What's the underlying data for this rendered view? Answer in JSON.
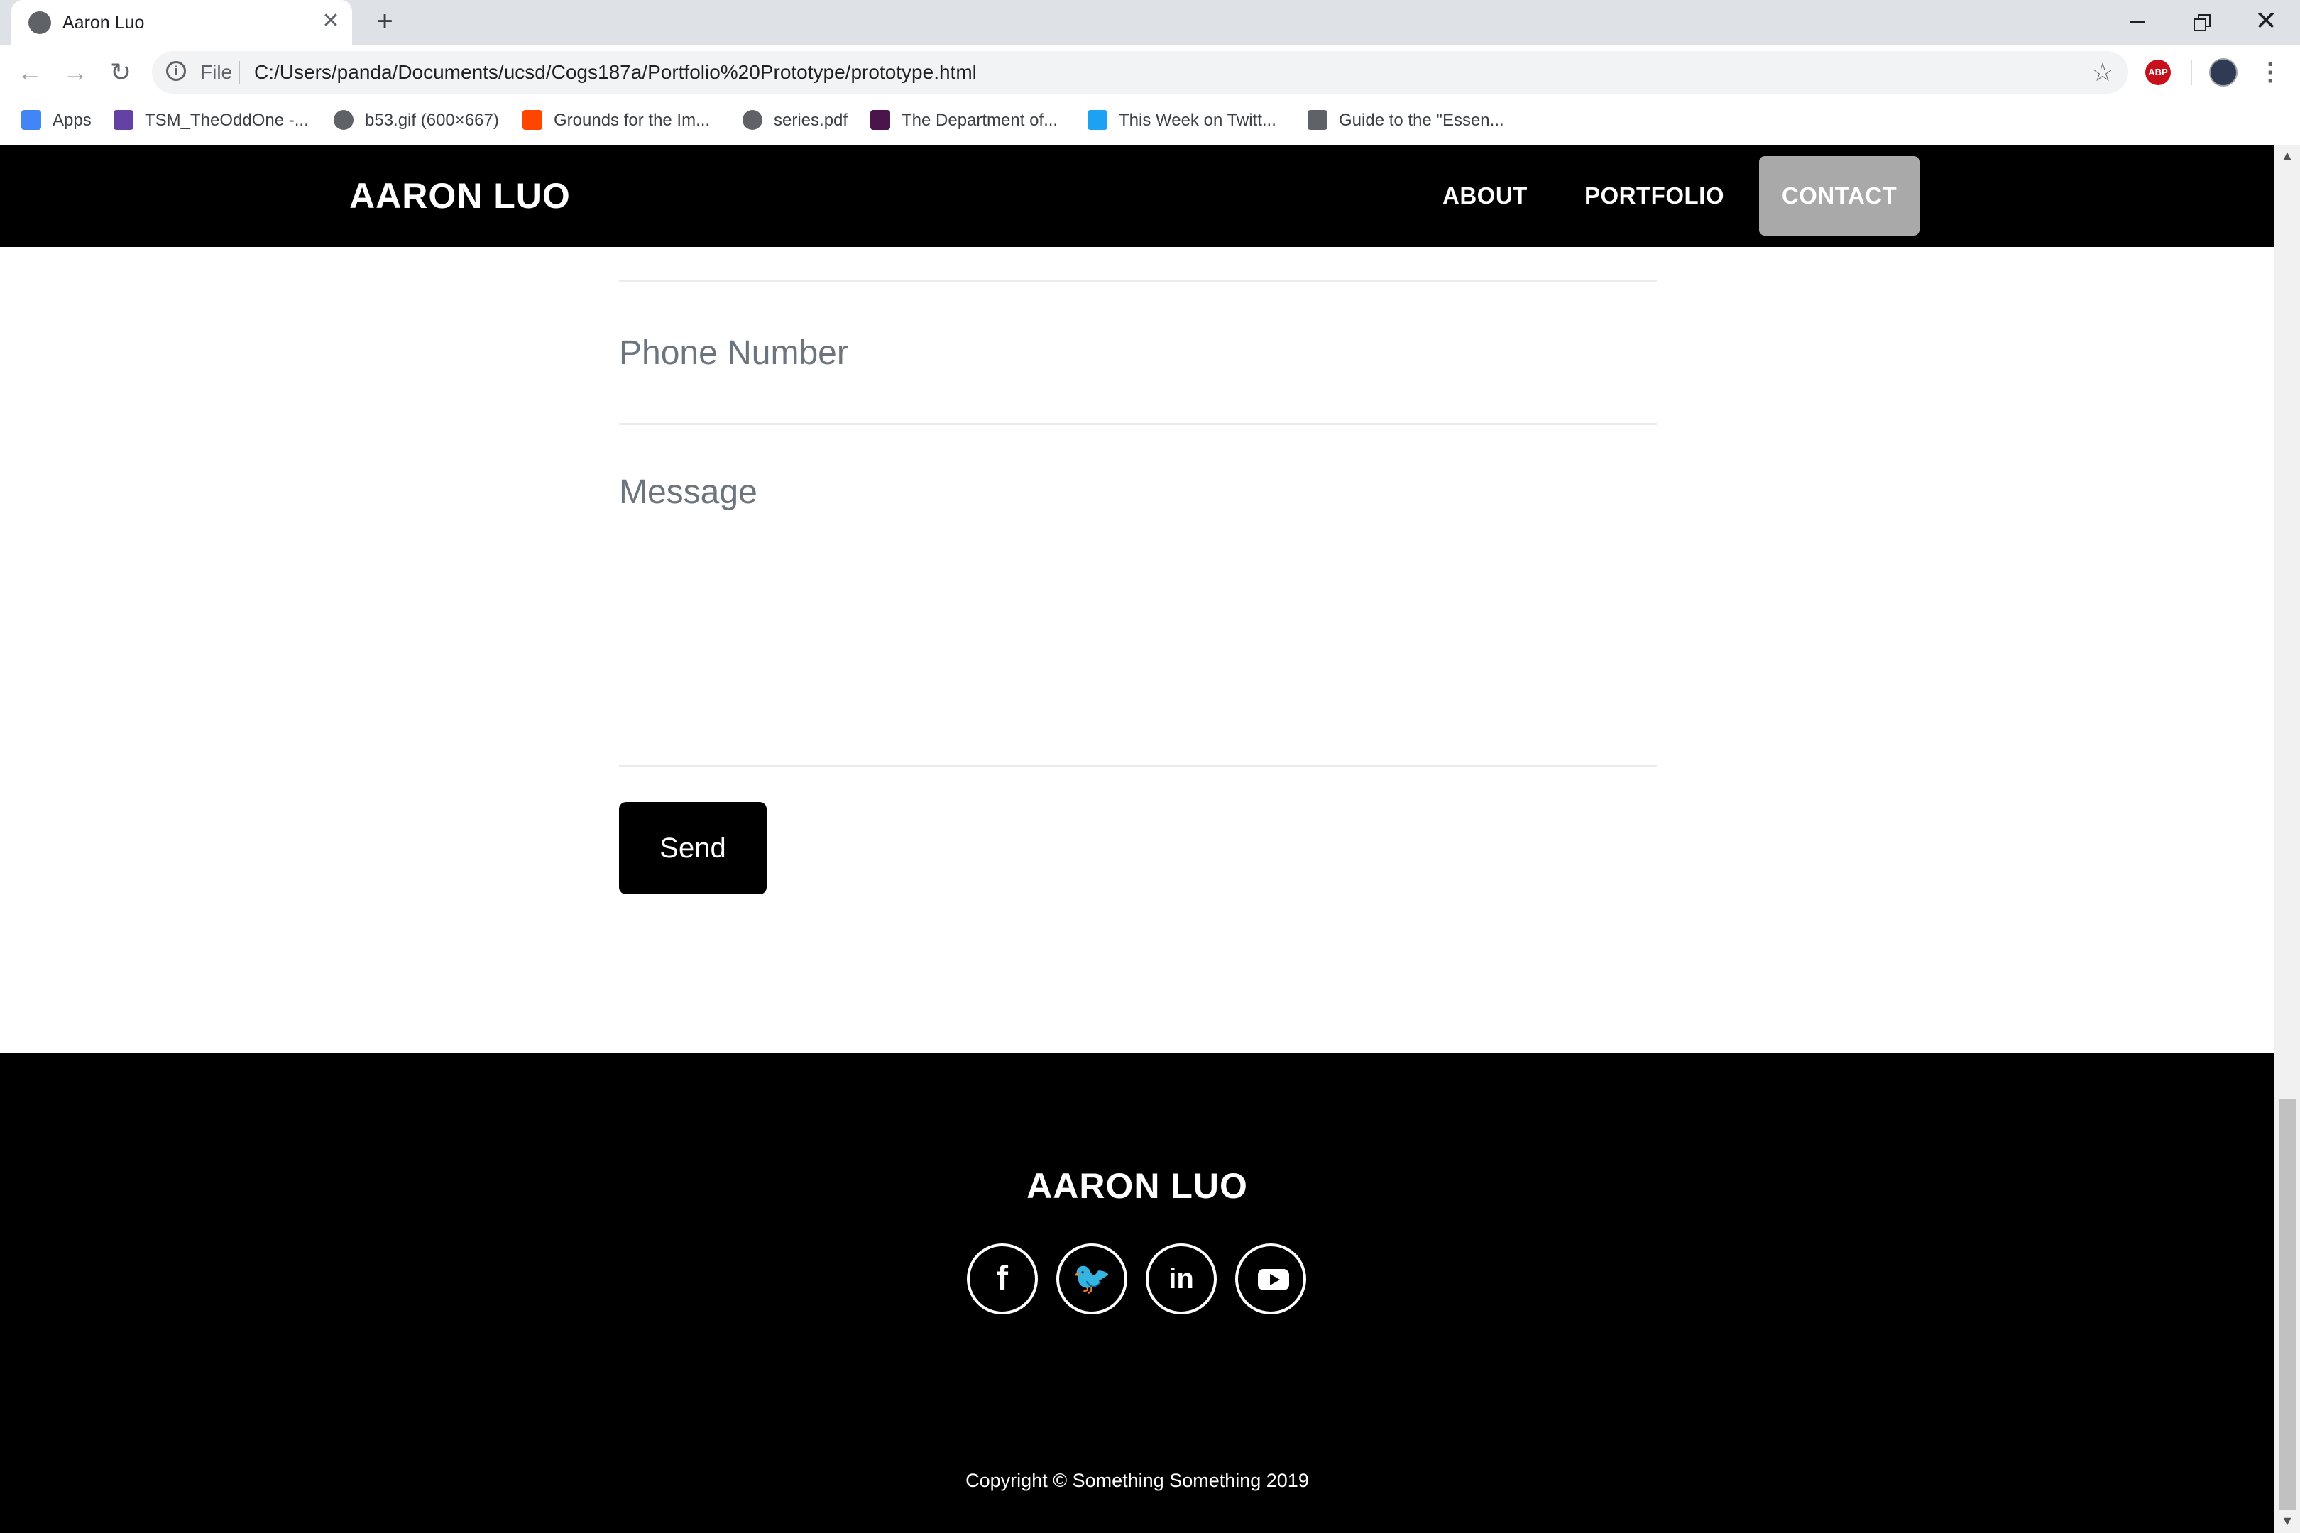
{
  "browser": {
    "tab_title": "Aaron Luo",
    "tab_close": "✕",
    "new_tab": "+",
    "window_close": "✕",
    "nav_back": "←",
    "nav_forward": "→",
    "nav_reload": "↻",
    "scheme_label": "File",
    "url": "C:/Users/panda/Documents/ucsd/Cogs187a/Portfolio%20Prototype/prototype.html",
    "star": "☆",
    "abp_label": "ABP",
    "menu": "⋮",
    "bookmarks": [
      {
        "label": "Apps",
        "icon": "apps-grid-icon",
        "color": "#4285f4"
      },
      {
        "label": "TSM_TheOddOne -...",
        "icon": "twitch-icon",
        "color": "#6441a5"
      },
      {
        "label": "b53.gif (600×667)",
        "icon": "globe-icon",
        "color": "#5f6368"
      },
      {
        "label": "Grounds for the Im...",
        "icon": "reddit-icon",
        "color": "#ff4500"
      },
      {
        "label": "series.pdf",
        "icon": "globe-icon",
        "color": "#5f6368"
      },
      {
        "label": "The Department of...",
        "icon": "slack-s-icon",
        "color": "#4a154b"
      },
      {
        "label": "This Week on Twitt...",
        "icon": "twitter-icon",
        "color": "#1da1f2"
      },
      {
        "label": "Guide to the \"Essen...",
        "icon": "guide-icon",
        "color": "#5f6368"
      }
    ]
  },
  "scrollbar": {
    "up": "▲",
    "down": "▼"
  },
  "site": {
    "brand": "AARON LUO",
    "nav": {
      "about": "ABOUT",
      "portfolio": "PORTFOLIO",
      "contact": "CONTACT"
    },
    "form": {
      "phone_placeholder": "Phone Number",
      "message_placeholder": "Message",
      "send_label": "Send"
    },
    "footer": {
      "brand": "AARON LUO",
      "social": {
        "facebook": "f",
        "twitter": "🐦",
        "linkedin": "in"
      },
      "copyright": "Copyright © Something Something 2019"
    }
  },
  "colors": {
    "nav_bg": "#000000",
    "contact_active_bg": "#a9a9a9",
    "placeholder_text": "#6c757d",
    "divider": "#e9ecef"
  }
}
